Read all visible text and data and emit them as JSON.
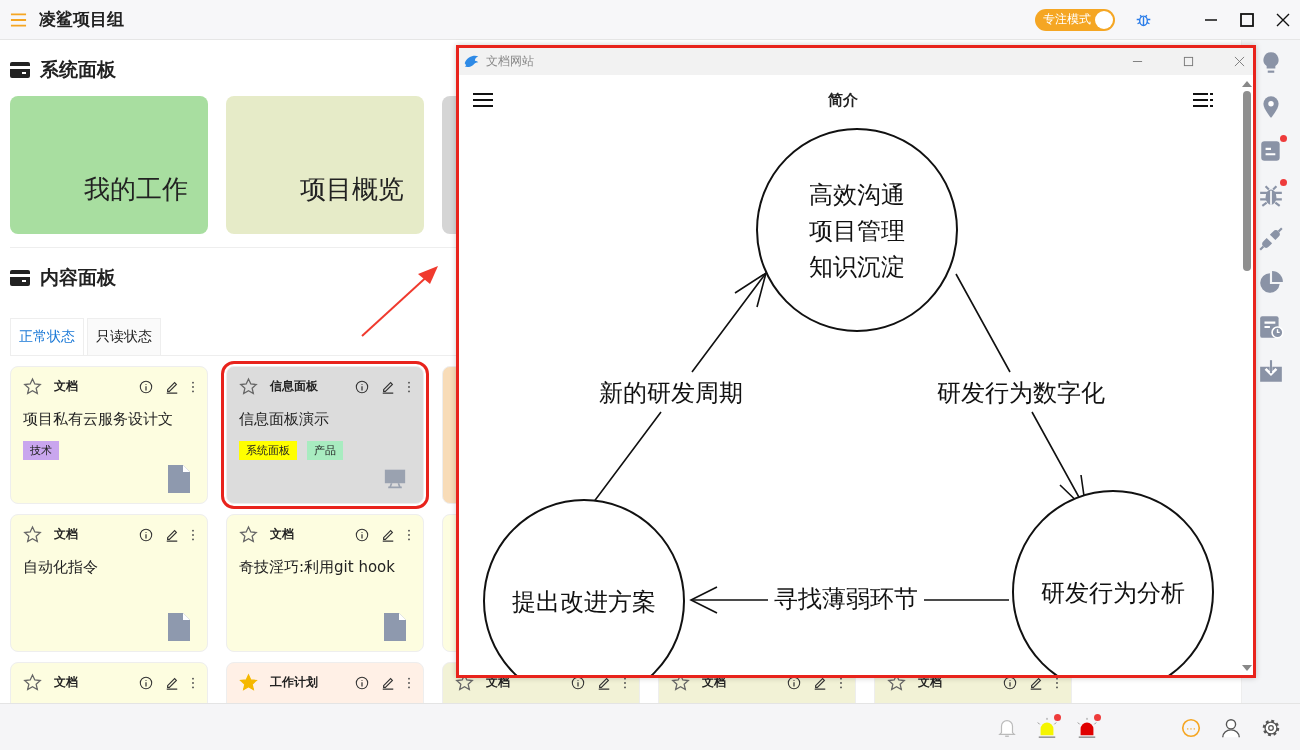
{
  "window": {
    "title": "凌鲨项目组",
    "focus_toggle": {
      "label": "专注模式",
      "on": true
    }
  },
  "system_panel": {
    "heading": "系统面板",
    "cards": [
      {
        "label": "我的工作",
        "color": "#a8dea0",
        "kind": "shown"
      },
      {
        "label": "项目概览",
        "color": "#e6ebc8",
        "kind": "shown"
      },
      {
        "color": "#d5d5d5",
        "kind": "covered"
      }
    ]
  },
  "content_panel": {
    "heading": "内容面板",
    "tabs": [
      {
        "label": "正常状态",
        "selected": true
      },
      {
        "label": "只读状态",
        "selected": false
      }
    ],
    "rows": [
      [
        {
          "kind": "doc",
          "category": "文档",
          "title": "项目私有云服务设计文",
          "starred": false,
          "color": "#fdfde0",
          "tags": [
            {
              "label": "技术",
              "color": "#c9a6ee"
            }
          ]
        },
        {
          "kind": "panel",
          "category": "信息面板",
          "title": "信息面板演示",
          "starred": false,
          "color": "#dcdcdc",
          "tags": [
            {
              "label": "系统面板",
              "color": "#ffff00"
            },
            {
              "label": "产品",
              "color": "#a8ecc0"
            }
          ],
          "highlighted": true
        },
        {
          "kind": "covered",
          "color": "#f8dcb8"
        }
      ],
      [
        {
          "kind": "doc",
          "category": "文档",
          "title": "自动化指令",
          "starred": false,
          "color": "#fdfde0"
        },
        {
          "kind": "doc",
          "category": "文档",
          "title": "奇技淫巧:利用git hook",
          "starred": false,
          "color": "#fdfde0"
        },
        {
          "kind": "covered",
          "color": "#fdfde0"
        }
      ],
      [
        {
          "kind": "doc",
          "category": "文档",
          "starred": false,
          "color": "#fdfde0"
        },
        {
          "kind": "plan",
          "category": "工作计划",
          "starred": true,
          "color": "#fff0e6"
        },
        {
          "kind": "doc",
          "category": "文档",
          "starred": false,
          "color": "#f2f2d6"
        },
        {
          "kind": "doc",
          "category": "文档",
          "starred": false,
          "color": "#f2f2d6"
        },
        {
          "kind": "doc",
          "category": "文档",
          "starred": false,
          "color": "#f2f2d6"
        }
      ]
    ]
  },
  "sidebar": {
    "items": [
      {
        "kind": "bulb",
        "badge": false
      },
      {
        "kind": "pin",
        "badge": false
      },
      {
        "kind": "note",
        "badge": true
      },
      {
        "kind": "bug",
        "badge": true
      },
      {
        "kind": "plug",
        "badge": false
      },
      {
        "kind": "pie",
        "badge": false
      },
      {
        "kind": "schedule",
        "badge": false
      },
      {
        "kind": "download",
        "badge": false
      }
    ]
  },
  "status_bar": {
    "items": [
      {
        "kind": "bell",
        "color": "#ffffff",
        "badge": false
      },
      {
        "kind": "siren",
        "color": "#f5f500",
        "badge": true
      },
      {
        "kind": "siren",
        "color": "#e00000",
        "badge": true
      },
      {
        "kind": "chat",
        "color": "#f5a623",
        "badge": false
      },
      {
        "kind": "user",
        "color": "#ffffff",
        "badge": false
      },
      {
        "kind": "gear",
        "color": "#ffffff",
        "badge": false
      }
    ]
  },
  "doc_window": {
    "title": "文档网站",
    "highlighted": true,
    "page_title": "简介",
    "diagram": {
      "nodes": [
        {
          "lines": [
            "高效沟通",
            "项目管理",
            "知识沉淀"
          ]
        },
        {
          "lines": [
            "研发行为分析"
          ]
        },
        {
          "lines": [
            "提出改进方案"
          ]
        }
      ],
      "edges": [
        {
          "label": "研发行为数字化"
        },
        {
          "label": "寻找薄弱环节"
        },
        {
          "label": "新的研发周期"
        }
      ]
    }
  }
}
